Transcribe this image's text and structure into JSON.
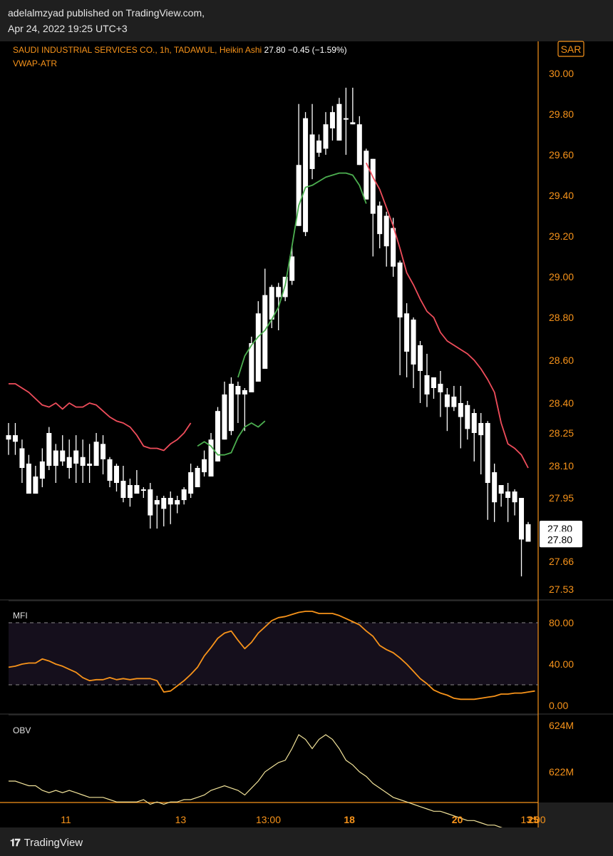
{
  "publisher": {
    "line1": "adelalmzyad published on TradingView.com,",
    "line2": "Apr 24, 2022 19:25 UTC+3"
  },
  "footer": {
    "logo_icon": "tradingview-logo-icon",
    "brand": "TradingView"
  },
  "colors": {
    "orange": "#f7931a",
    "vwap_up": "#4caf50",
    "vwap_down": "#ef4d5b",
    "obv_line": "#f2e39a",
    "panel_bg": "#000000",
    "mfi_band": "#150f1c",
    "candle": "#ffffff"
  },
  "chart_data": [
    {
      "type": "candlestick",
      "title": "SAUDI INDUSTRIAL SERVICES CO., 1h, TADAWUL, Heikin Ashi",
      "last_value_text": "27.80",
      "change_text": "−0.45 (−1.59%)",
      "indicator_label": "VWAP-ATR",
      "currency": "SAR",
      "price_labels": [
        "27.80",
        "27.80"
      ],
      "y_ticks": [
        30.0,
        29.8,
        29.6,
        29.4,
        29.2,
        29.0,
        28.8,
        28.6,
        28.4,
        28.25,
        28.1,
        27.95,
        27.66,
        27.53
      ],
      "y_tick_labels": [
        "30.00",
        "29.80",
        "29.60",
        "29.40",
        "29.20",
        "29.00",
        "28.80",
        "28.60",
        "28.40",
        "28.25",
        "28.10",
        "27.95",
        "27.66",
        "27.53"
      ],
      "x_tick_labels": [
        "11",
        "13",
        "13:00",
        "18",
        "20",
        "13:00",
        "25"
      ],
      "candles": [
        [
          28.22,
          28.24,
          28.3,
          28.15
        ],
        [
          28.24,
          28.21,
          28.3,
          28.15
        ],
        [
          28.18,
          28.09,
          28.22,
          28.02
        ],
        [
          28.11,
          27.97,
          28.15,
          27.97
        ],
        [
          28.05,
          27.97,
          28.1,
          27.97
        ],
        [
          28.12,
          28.04,
          28.18,
          28.0
        ],
        [
          28.1,
          28.25,
          28.28,
          28.08
        ],
        [
          28.17,
          28.1,
          28.2,
          28.02
        ],
        [
          28.17,
          28.12,
          28.24,
          28.1
        ],
        [
          28.14,
          28.09,
          28.22,
          28.04
        ],
        [
          28.17,
          28.11,
          28.24,
          28.02
        ],
        [
          28.14,
          28.1,
          28.22,
          28.02
        ],
        [
          28.11,
          28.1,
          28.2,
          28.02
        ],
        [
          28.1,
          28.21,
          28.25,
          28.1
        ],
        [
          28.2,
          28.13,
          28.24,
          28.06
        ],
        [
          28.13,
          28.03,
          28.14,
          28.0
        ],
        [
          28.1,
          28.02,
          28.11,
          27.98
        ],
        [
          28.03,
          27.95,
          28.1,
          27.93
        ],
        [
          28.01,
          27.95,
          28.04,
          27.91
        ],
        [
          28.01,
          27.97,
          28.08,
          27.97
        ],
        [
          27.99,
          27.99,
          28.0,
          27.95
        ],
        [
          27.99,
          27.87,
          28.02,
          27.81
        ],
        [
          27.92,
          27.94,
          27.96,
          27.81
        ],
        [
          27.95,
          27.9,
          27.96,
          27.82
        ],
        [
          27.95,
          27.92,
          27.98,
          27.83
        ],
        [
          27.92,
          27.94,
          27.96,
          27.88
        ],
        [
          27.94,
          27.99,
          28.0,
          27.92
        ],
        [
          27.97,
          28.07,
          28.11,
          27.95
        ],
        [
          28.0,
          28.09,
          28.1,
          28.03
        ],
        [
          28.07,
          28.13,
          28.17,
          28.05
        ],
        [
          28.05,
          28.22,
          28.25,
          28.05
        ],
        [
          28.12,
          28.36,
          28.38,
          28.12
        ],
        [
          28.22,
          28.44,
          28.5,
          28.22
        ],
        [
          28.26,
          28.49,
          28.52,
          28.24
        ],
        [
          28.48,
          28.44,
          28.5,
          28.3
        ],
        [
          28.44,
          28.46,
          28.47,
          28.26
        ],
        [
          28.45,
          28.68,
          28.71,
          28.45
        ],
        [
          28.5,
          28.82,
          28.88,
          28.5
        ],
        [
          28.56,
          28.91,
          29.04,
          28.56
        ],
        [
          28.79,
          28.95,
          28.96,
          28.75
        ],
        [
          28.9,
          28.95,
          28.97,
          28.74
        ],
        [
          29.0,
          28.9,
          29.0,
          28.88
        ],
        [
          28.98,
          29.1,
          29.15,
          28.96
        ],
        [
          29.25,
          29.55,
          29.85,
          29.25
        ],
        [
          29.22,
          29.78,
          29.81,
          29.2
        ],
        [
          29.53,
          29.7,
          29.85,
          29.48
        ],
        [
          29.67,
          29.61,
          29.7,
          29.59
        ],
        [
          29.63,
          29.75,
          29.81,
          29.6
        ],
        [
          29.81,
          29.73,
          29.84,
          29.67
        ],
        [
          29.67,
          29.85,
          29.88,
          29.67
        ],
        [
          29.78,
          29.78,
          29.93,
          29.6
        ],
        [
          29.76,
          29.75,
          29.93,
          29.75
        ],
        [
          29.75,
          29.55,
          29.79,
          29.55
        ],
        [
          29.62,
          29.38,
          29.63,
          29.4
        ],
        [
          29.58,
          29.31,
          29.58,
          29.1
        ],
        [
          29.35,
          29.21,
          29.37,
          29.14
        ],
        [
          29.3,
          29.15,
          29.32,
          29.05
        ],
        [
          29.24,
          29.05,
          29.29,
          29.0
        ],
        [
          29.07,
          28.8,
          29.08,
          28.53
        ],
        [
          28.82,
          28.64,
          28.87,
          28.52
        ],
        [
          28.79,
          28.58,
          28.8,
          28.47
        ],
        [
          28.67,
          28.55,
          28.69,
          28.4
        ],
        [
          28.53,
          28.44,
          28.63,
          28.38
        ],
        [
          28.47,
          28.52,
          28.52,
          28.42
        ],
        [
          28.49,
          28.45,
          28.55,
          28.33
        ],
        [
          28.44,
          28.38,
          28.47,
          28.26
        ],
        [
          28.43,
          28.38,
          28.48,
          28.36
        ],
        [
          28.4,
          28.33,
          28.48,
          28.18
        ],
        [
          28.39,
          28.27,
          28.41,
          28.22
        ],
        [
          28.35,
          28.25,
          28.37,
          28.12
        ],
        [
          28.3,
          28.24,
          28.35,
          28.06
        ],
        [
          28.3,
          28.02,
          28.31,
          27.85
        ],
        [
          28.07,
          27.93,
          28.11,
          27.84
        ],
        [
          28.01,
          27.97,
          28.01,
          27.91
        ],
        [
          27.98,
          27.95,
          28.02,
          27.84
        ],
        [
          27.98,
          27.93,
          27.99,
          27.87
        ],
        [
          27.95,
          27.76,
          27.95,
          27.59
        ],
        [
          27.83,
          27.75,
          27.84,
          27.76
        ]
      ],
      "vwap_up": [
        [
          28.19,
          28.21,
          28.19,
          28.15,
          28.15,
          28.16,
          28.23,
          28.28,
          28.3,
          28.28,
          28.31
        ],
        [
          28.52,
          28.62,
          28.67,
          28.71,
          28.74,
          28.79,
          28.85,
          28.96,
          29.15,
          29.35,
          29.44,
          29.45,
          29.47,
          29.49,
          29.5,
          29.51,
          29.51,
          29.5,
          29.45,
          29.36
        ]
      ],
      "vwap_down": [
        [
          28.49,
          28.49,
          28.47,
          28.45,
          28.42,
          28.39,
          28.38,
          28.4,
          28.37,
          28.4,
          28.38,
          28.38,
          28.4,
          28.39,
          28.36,
          28.33,
          28.31,
          28.3,
          28.28,
          28.24,
          28.19,
          28.18,
          28.18,
          28.17,
          28.2,
          28.22,
          28.25,
          28.3
        ],
        [
          29.56,
          29.49,
          29.43,
          29.34,
          29.25,
          29.14,
          29.02,
          28.96,
          28.89,
          28.83,
          28.8,
          28.73,
          28.69,
          28.67,
          28.65,
          28.63,
          28.6,
          28.56,
          28.51,
          28.45,
          28.3,
          28.2,
          28.18,
          28.15,
          28.09
        ]
      ]
    },
    {
      "type": "line",
      "title": "MFI",
      "y_ticks": [
        80,
        40,
        0
      ],
      "y_tick_labels": [
        "80.00",
        "40.00",
        "0.00"
      ],
      "bands": [
        80,
        20
      ],
      "values": [
        37,
        38,
        40,
        41,
        41,
        45,
        43,
        40,
        38,
        35,
        32,
        27,
        24,
        25,
        25,
        27,
        25,
        26,
        25,
        26,
        26,
        26,
        24,
        13,
        14,
        19,
        24,
        30,
        37,
        48,
        56,
        65,
        70,
        72,
        63,
        55,
        61,
        70,
        76,
        82,
        85,
        86,
        88,
        90,
        91,
        91,
        89,
        89,
        89,
        87,
        84,
        81,
        78,
        72,
        67,
        58,
        54,
        51,
        46,
        40,
        33,
        26,
        21,
        15,
        12,
        10,
        7,
        6,
        6,
        6,
        7,
        8,
        9,
        11,
        11,
        12,
        12,
        13,
        14
      ]
    },
    {
      "type": "line",
      "title": "OBV",
      "y_ticks": [
        624,
        622
      ],
      "y_tick_labels": [
        "624M",
        "622M"
      ],
      "values": [
        621.6,
        621.6,
        621.5,
        621.4,
        621.4,
        621.2,
        621.1,
        621.2,
        621.1,
        621.2,
        621.1,
        621.0,
        620.9,
        620.9,
        620.9,
        620.8,
        620.7,
        620.7,
        620.7,
        620.7,
        620.8,
        620.6,
        620.7,
        620.6,
        620.7,
        620.7,
        620.8,
        620.8,
        620.9,
        621.0,
        621.2,
        621.3,
        621.4,
        621.3,
        621.2,
        621.0,
        621.3,
        621.6,
        622.0,
        622.2,
        622.4,
        622.5,
        623.0,
        623.6,
        623.4,
        623.0,
        623.4,
        623.6,
        623.4,
        623.0,
        622.5,
        622.3,
        622.0,
        621.8,
        621.5,
        621.3,
        621.1,
        620.9,
        620.8,
        620.7,
        620.6,
        620.5,
        620.4,
        620.3,
        620.3,
        620.2,
        620.1,
        620.0,
        619.9,
        619.9,
        619.8,
        619.7,
        619.7,
        619.6,
        619.5,
        619.5,
        619.4,
        619.4,
        619.4
      ]
    }
  ]
}
